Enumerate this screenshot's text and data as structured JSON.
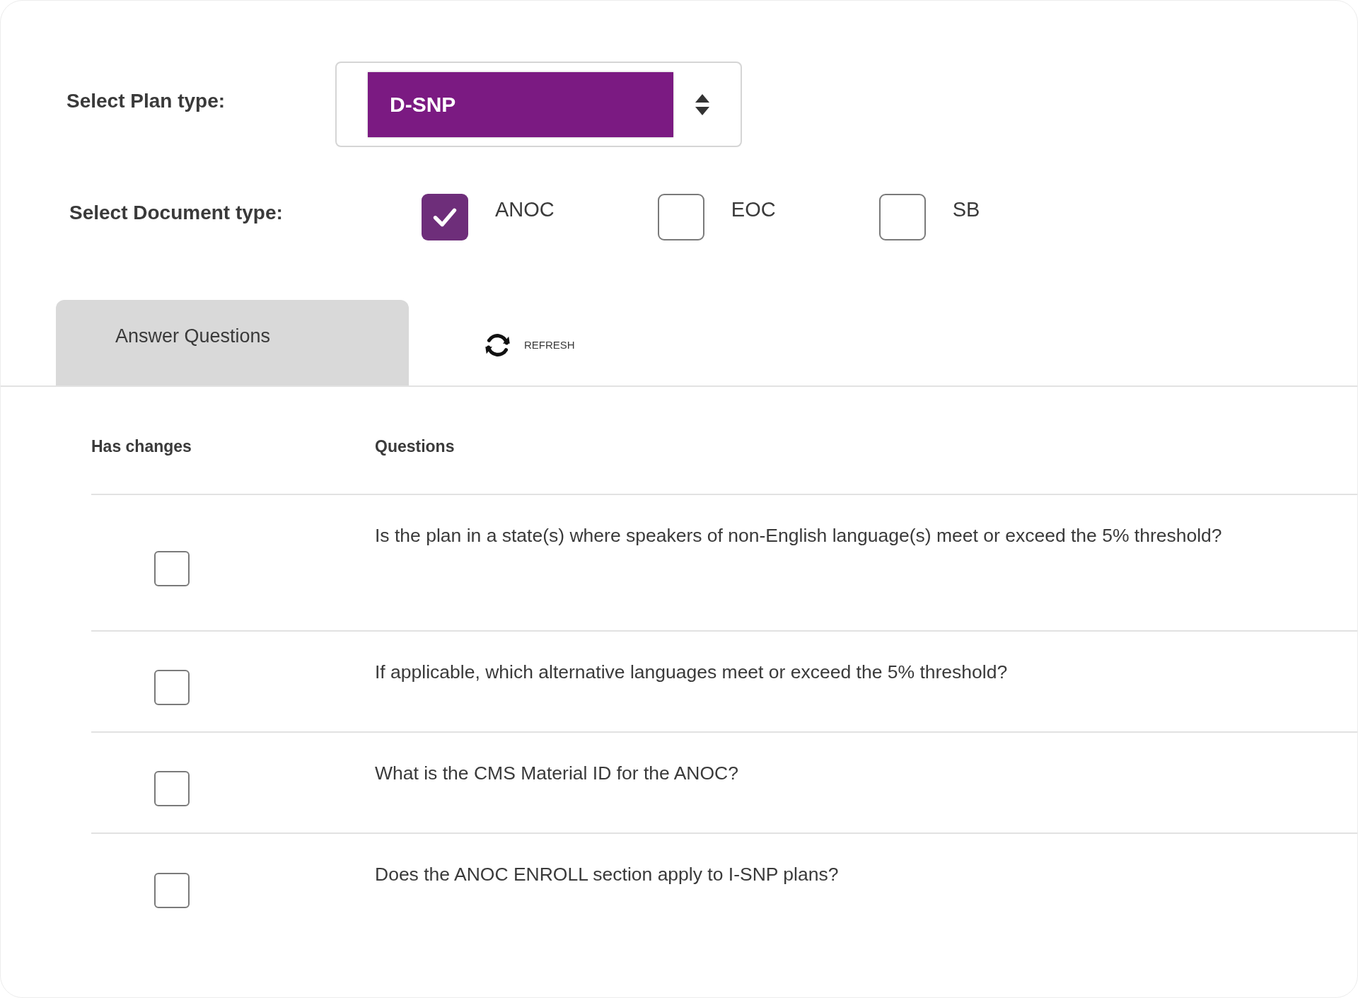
{
  "plan_type": {
    "label": "Select Plan type:",
    "value": "D-SNP"
  },
  "document_type": {
    "label": "Select Document type:",
    "options": [
      {
        "label": "ANOC",
        "checked": true
      },
      {
        "label": "EOC",
        "checked": false
      },
      {
        "label": "SB",
        "checked": false
      }
    ]
  },
  "tabs": [
    {
      "label": "Answer Questions",
      "selected": true
    }
  ],
  "refresh_button": {
    "label": "REFRESH"
  },
  "table": {
    "columns": [
      "Has changes",
      "Questions"
    ],
    "rows": [
      {
        "has_changes": false,
        "question": "Is the plan in a state(s) where speakers of non-English language(s) meet or exceed the 5% threshold?"
      },
      {
        "has_changes": false,
        "question": "If applicable, which alternative languages meet or exceed the 5% threshold?"
      },
      {
        "has_changes": false,
        "question": "What is the CMS Material ID for the ANOC?"
      },
      {
        "has_changes": false,
        "question": "Does the ANOC ENROLL section apply to I-SNP plans?"
      }
    ]
  }
}
